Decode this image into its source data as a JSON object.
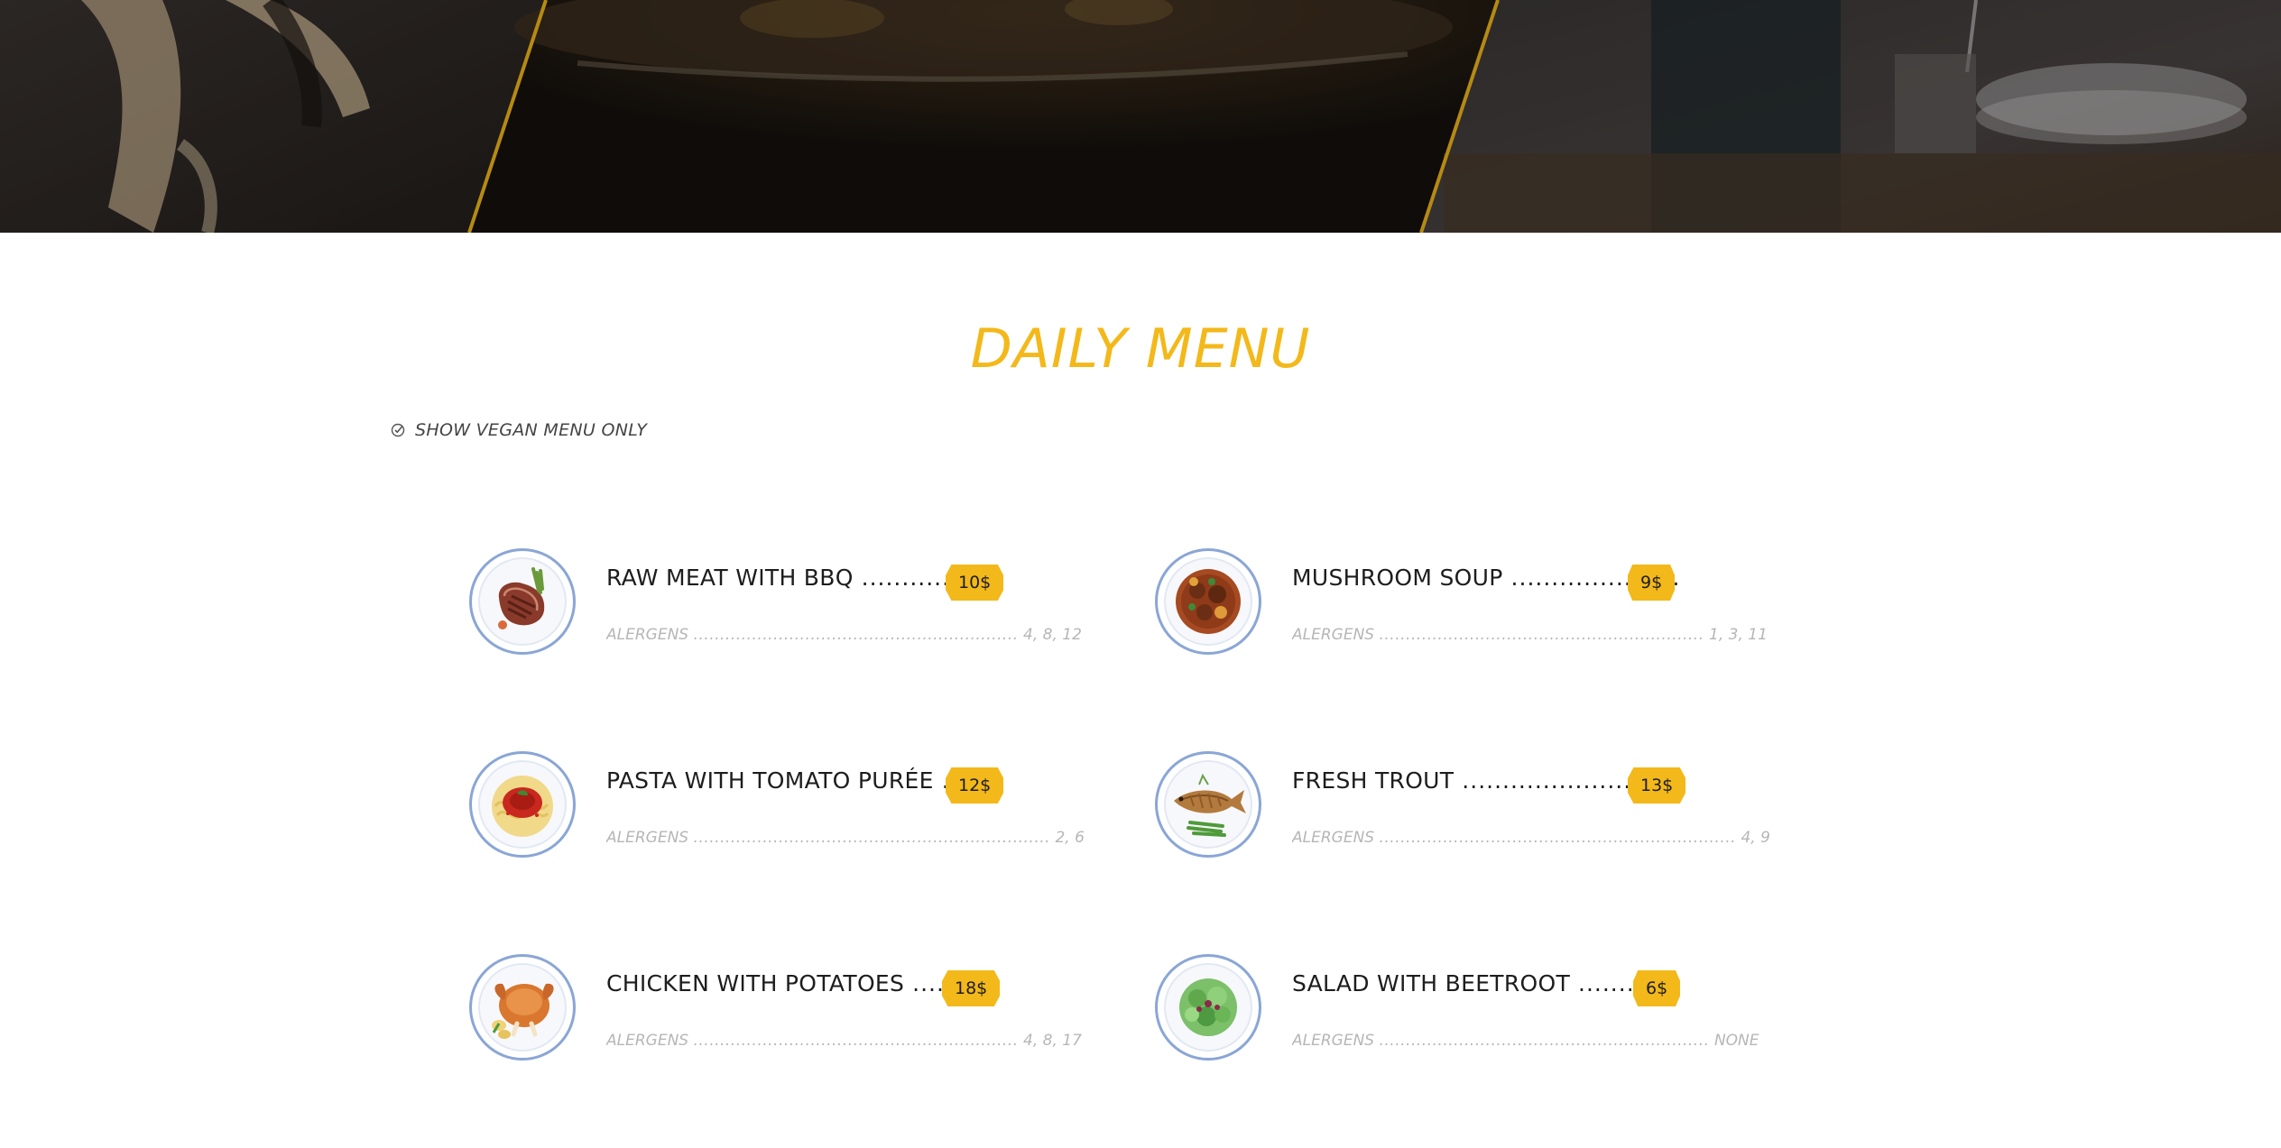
{
  "section": {
    "title": "DAILY MENU",
    "vegan_filter_label": "SHOW VEGAN MENU ONLY"
  },
  "colors": {
    "accent": "#f3b81a",
    "text": "#1d1d1d",
    "muted": "#b6b6b6",
    "plate_rim": "#8aa6d6"
  },
  "menu": {
    "allergens_label": "ALERGENS",
    "items": [
      {
        "name": "RAW MEAT WITH BBQ",
        "price": "10$",
        "allergens": "4, 8, 12",
        "icon": "steak-plate-icon"
      },
      {
        "name": "MUSHROOM SOUP",
        "price": "9$",
        "allergens": "1, 3, 11",
        "icon": "soup-plate-icon"
      },
      {
        "name": "PASTA WITH TOMATO PURÉE",
        "price": "12$",
        "allergens": "2, 6",
        "icon": "pasta-plate-icon"
      },
      {
        "name": "FRESH TROUT",
        "price": "13$",
        "allergens": "4, 9",
        "icon": "fish-plate-icon"
      },
      {
        "name": "CHICKEN WITH POTATOES",
        "price": "18$",
        "allergens": "4, 8, 17",
        "icon": "chicken-plate-icon"
      },
      {
        "name": "SALAD WITH BEETROOT",
        "price": "6$",
        "allergens": "NONE",
        "icon": "salad-plate-icon"
      }
    ]
  }
}
